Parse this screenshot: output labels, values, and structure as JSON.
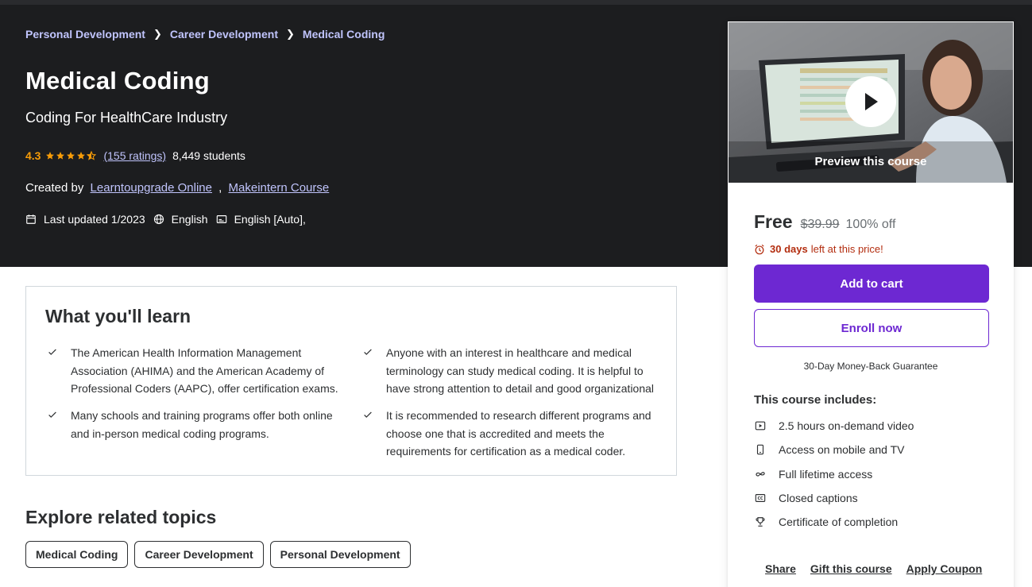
{
  "breadcrumb": [
    "Personal Development",
    "Career Development",
    "Medical Coding"
  ],
  "course": {
    "title": "Medical Coding",
    "subtitle": "Coding For HealthCare Industry",
    "rating": "4.3",
    "rating_fraction": 0.86,
    "ratings_count": "(155 ratings)",
    "students": "8,449 students",
    "created_by_label": "Created by",
    "instructors": [
      "Learntoupgrade Online",
      "Makeintern Course"
    ],
    "instructor_sep": ",",
    "last_updated": "Last updated 1/2023",
    "language": "English",
    "captions": "English [Auto],"
  },
  "learn": {
    "title": "What you'll learn",
    "items": [
      "The American Health Information Management Association (AHIMA) and the American Academy of Professional Coders (AAPC), offer certification exams.",
      "Anyone with an interest in healthcare and medical terminology can study medical coding. It is helpful to have strong attention to detail and good organizational",
      "Many schools and training programs offer both online and in-person medical coding programs.",
      "It is recommended to research different programs and choose one that is accredited and meets the requirements for certification as a medical coder."
    ]
  },
  "explore": {
    "title": "Explore related topics",
    "topics": [
      "Medical Coding",
      "Career Development",
      "Personal Development"
    ]
  },
  "sidebar": {
    "preview_label": "Preview this course",
    "price": "Free",
    "old_price": "$39.99",
    "discount": "100% off",
    "timer_bold": "30 days",
    "timer_text": "left at this price!",
    "add_to_cart": "Add to cart",
    "enroll": "Enroll now",
    "guarantee": "30-Day Money-Back Guarantee",
    "includes_title": "This course includes:",
    "includes": [
      {
        "icon": "video-icon",
        "text": "2.5 hours on-demand video"
      },
      {
        "icon": "mobile-icon",
        "text": "Access on mobile and TV"
      },
      {
        "icon": "infinity-icon",
        "text": "Full lifetime access"
      },
      {
        "icon": "closed-captions-icon",
        "text": "Closed captions"
      },
      {
        "icon": "trophy-icon",
        "text": "Certificate of completion"
      }
    ],
    "footer_links": [
      "Share",
      "Gift this course",
      "Apply Coupon"
    ]
  },
  "colors": {
    "hero_bg": "#1c1d1f",
    "link": "#c0c4fc",
    "star": "#f69c08",
    "primary": "#6d28d2",
    "timer": "#b32d0f"
  }
}
